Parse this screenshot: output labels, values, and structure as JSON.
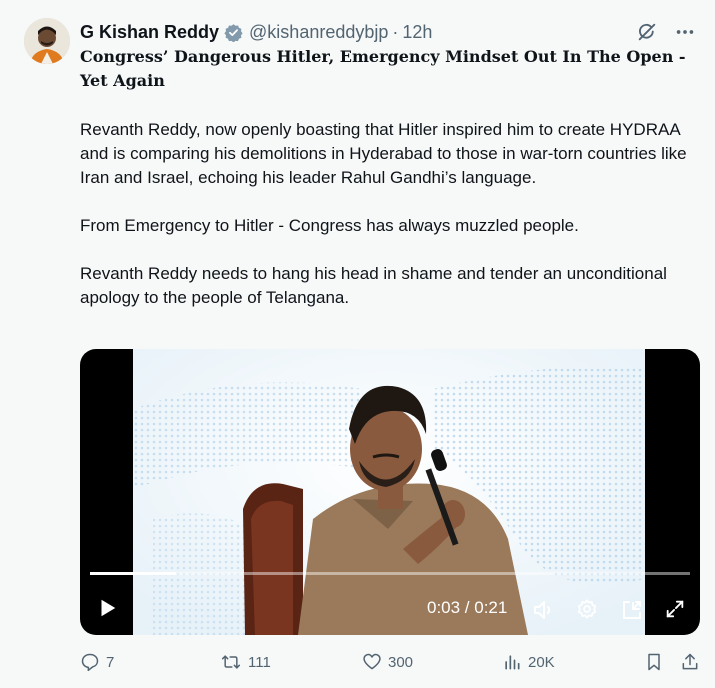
{
  "author": {
    "name": "G Kishan Reddy",
    "handle": "@kishanreddybjp",
    "separator": "·",
    "time": "12h"
  },
  "tweet": {
    "title": "Congress’ Dangerous Hitler, Emergency Mindset Out In The Open - Yet Again",
    "paragraphs": [
      "Revanth Reddy, now openly boasting that Hitler inspired him to create HYDRAA and is comparing his demolitions in Hyderabad to those in war-torn countries like Iran and Israel, echoing his leader Rahul Gandhi’s language.",
      "From Emergency to Hitler - Congress has always muzzled people.",
      "Revanth Reddy needs to hang his head in shame and tender an unconditional apology to the people of Telangana."
    ]
  },
  "video": {
    "time_display": "0:03 / 0:21",
    "progress": 0.143
  },
  "stats": {
    "replies": "7",
    "reposts": "111",
    "likes": "300",
    "views": "20K"
  },
  "colors": {
    "background": "#f7f9f9",
    "text": "#0f1419",
    "secondary": "#536471",
    "verified": "#829aab"
  }
}
